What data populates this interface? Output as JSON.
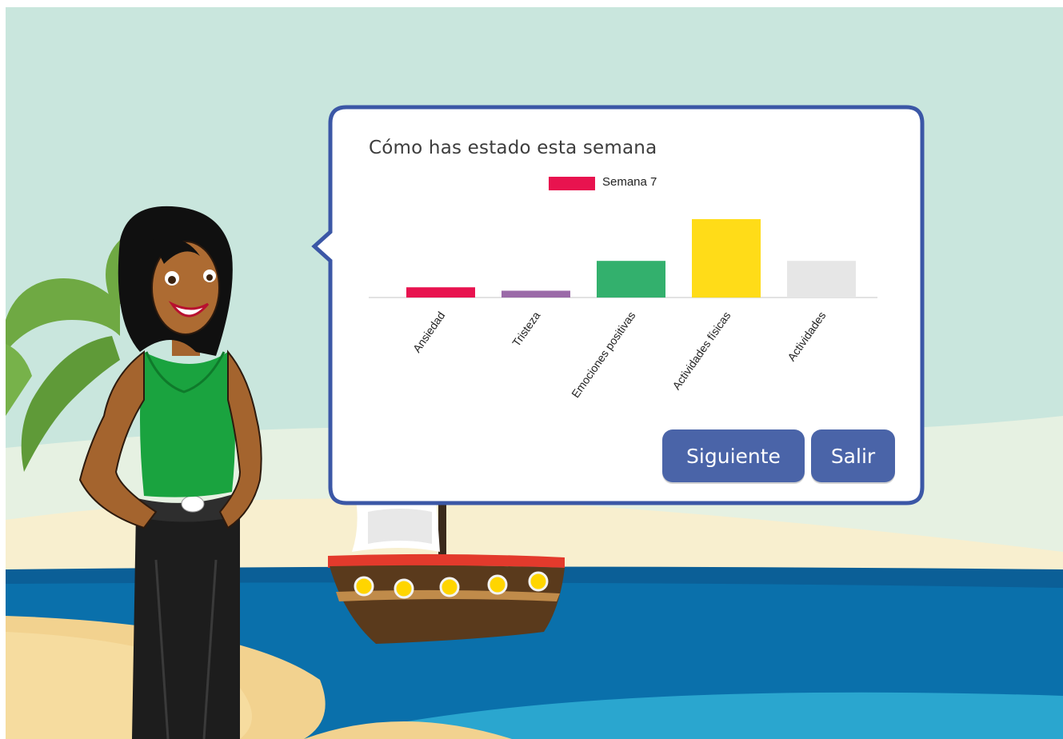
{
  "dialog": {
    "title": "Cómo has estado esta semana",
    "next_label": "Siguiente",
    "exit_label": "Salir"
  },
  "colors": {
    "accent_border": "#3b57a6",
    "button": "#4a64a8"
  },
  "chart_data": {
    "type": "bar",
    "title": "Cómo has estado esta semana",
    "categories": [
      "Ansiedad",
      "Tristeza",
      "Emociones positivas",
      "Actividades físicas",
      "Actividades"
    ],
    "series": [
      {
        "name": "Semana 7",
        "values": [
          1.2,
          0.8,
          4.3,
          9.2,
          4.3
        ]
      }
    ],
    "bar_colors": [
      "#e8134f",
      "#9b6aa8",
      "#33b06d",
      "#ffdc18",
      "#e6e6e6"
    ],
    "ylim": [
      0,
      9.2
    ],
    "legend": "top-center",
    "grid": false
  }
}
